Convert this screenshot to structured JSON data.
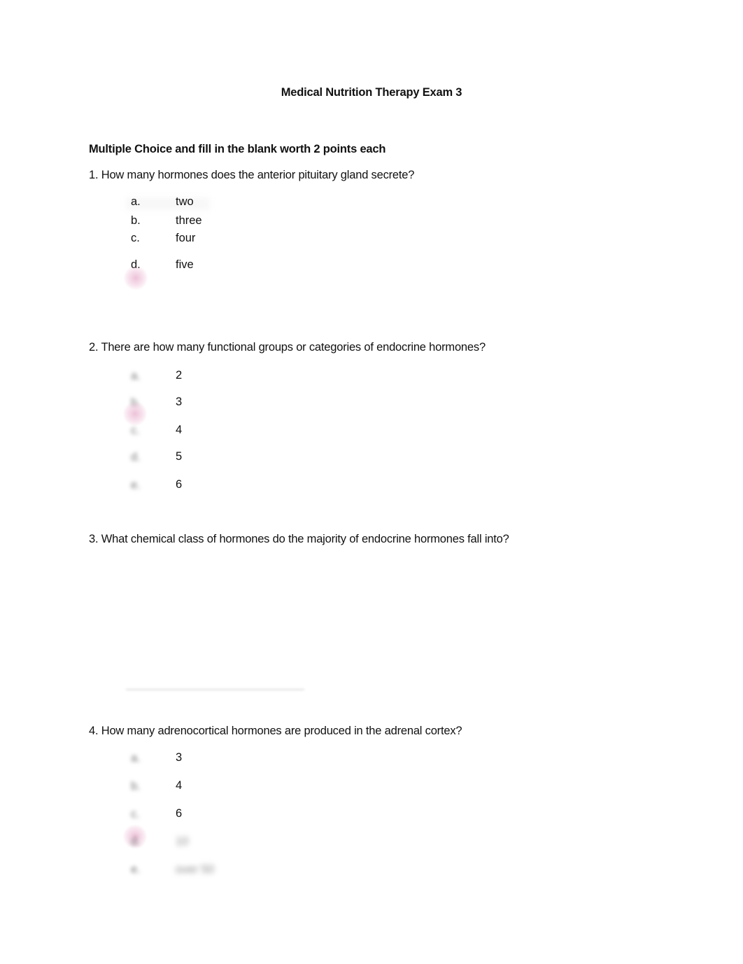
{
  "document": {
    "title": "Medical Nutrition Therapy Exam 3",
    "section_heading": "Multiple Choice and ﬁll in the blank worth 2 points each",
    "questions": [
      {
        "number": "1.",
        "text": "1. How many hormones does the anterior pituitary gland secrete?",
        "options": [
          {
            "letter": "a.",
            "text": "two"
          },
          {
            "letter": "b.",
            "text": "three"
          },
          {
            "letter": "c.",
            "text": "four"
          },
          {
            "letter": "d.",
            "text": "five"
          }
        ]
      },
      {
        "number": "2.",
        "text": "2. There are how many functional groups or categories of endocrine hormones?",
        "options": [
          {
            "letter": "a.",
            "text": "2"
          },
          {
            "letter": "b.",
            "text": "3"
          },
          {
            "letter": "c.",
            "text": "4"
          },
          {
            "letter": "d.",
            "text": "5"
          },
          {
            "letter": "e.",
            "text": "6"
          }
        ]
      },
      {
        "number": "3.",
        "text": "3. What chemical class of hormones do the majority of endocrine hormones fall into?",
        "answer_blank": "________________________"
      },
      {
        "number": "4.",
        "text": "4. How many adrenocortical hormones are produced in the adrenal cortex?",
        "options": [
          {
            "letter": "a.",
            "text": "3"
          },
          {
            "letter": "b.",
            "text": "4"
          },
          {
            "letter": "c.",
            "text": "6"
          },
          {
            "letter": "d.",
            "text": "10"
          },
          {
            "letter": "e.",
            "text": "over 50"
          }
        ]
      }
    ]
  }
}
